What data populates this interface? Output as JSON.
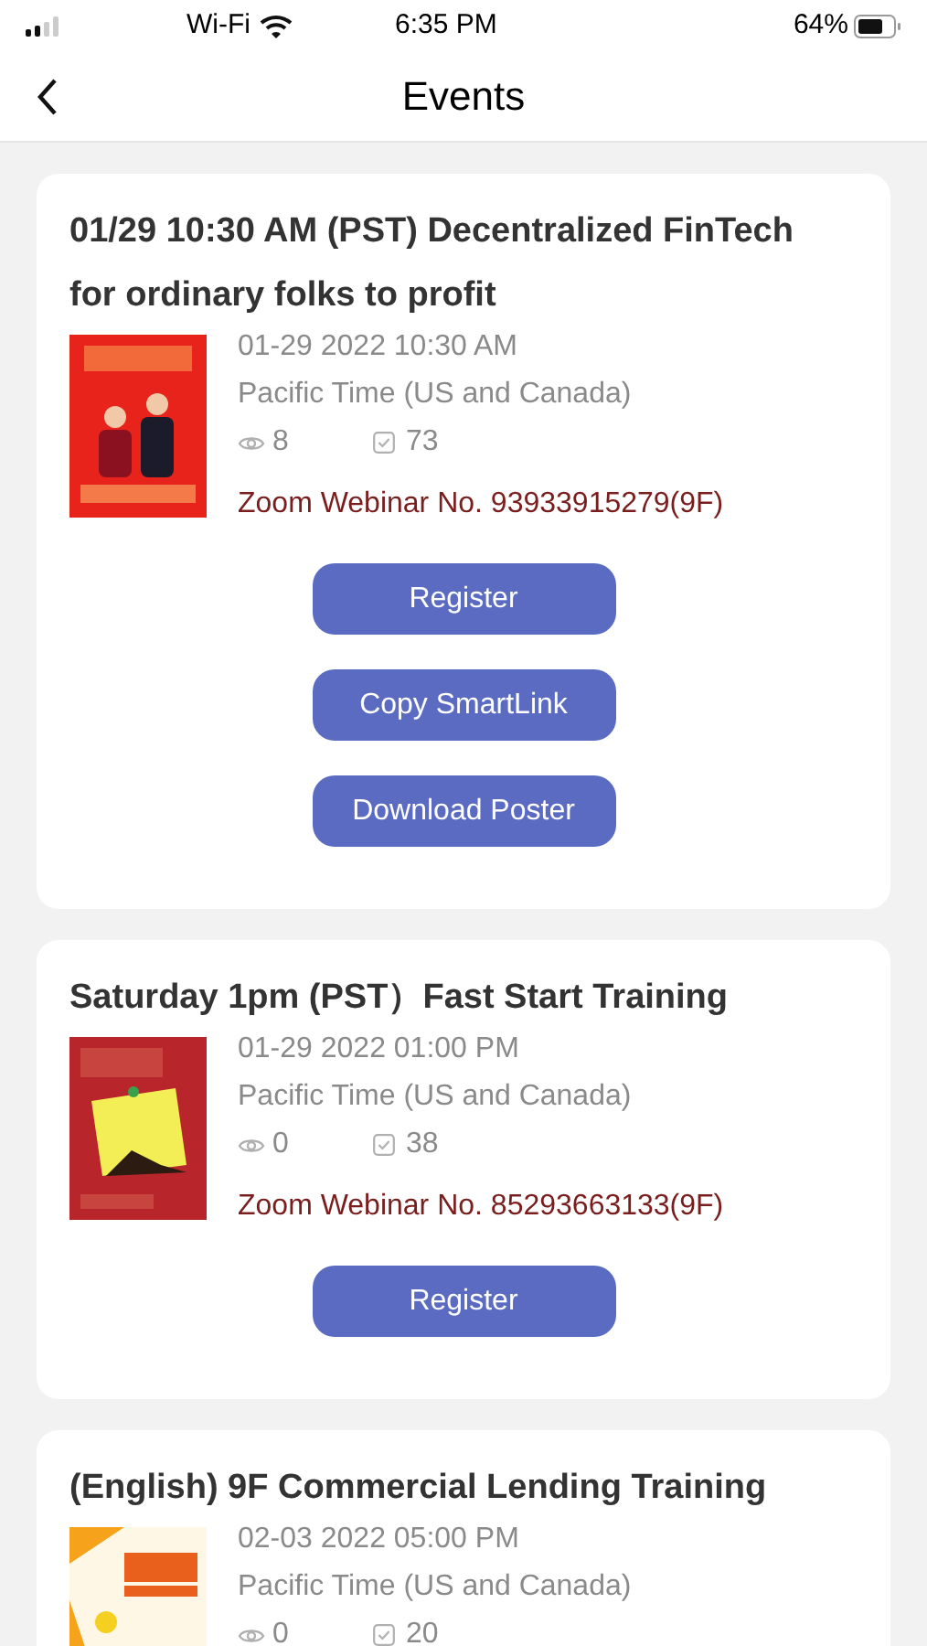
{
  "status_bar": {
    "carrier": "Wi-Fi",
    "time": "6:35 PM",
    "battery": "64%"
  },
  "nav": {
    "title": "Events"
  },
  "events": [
    {
      "title": "01/29 10:30 AM (PST) Decentralized FinTech for ordinary folks to profit",
      "date": "01-29 2022 10:30 AM",
      "timezone": "Pacific Time (US and Canada)",
      "views": "8",
      "registrations": "73",
      "webinar": "Zoom Webinar No. 93933915279(9F)",
      "buttons": [
        "Register",
        "Copy SmartLink",
        "Download Poster"
      ]
    },
    {
      "title": "Saturday 1pm (PST）Fast Start Training",
      "date": "01-29 2022 01:00 PM",
      "timezone": "Pacific Time (US and Canada)",
      "views": "0",
      "registrations": "38",
      "webinar": "Zoom Webinar No. 85293663133(9F)",
      "buttons": [
        "Register"
      ]
    },
    {
      "title": "(English) 9F Commercial Lending Training",
      "date": "02-03 2022 05:00 PM",
      "timezone": "Pacific Time (US and Canada)",
      "views": "0",
      "registrations": "20"
    }
  ]
}
